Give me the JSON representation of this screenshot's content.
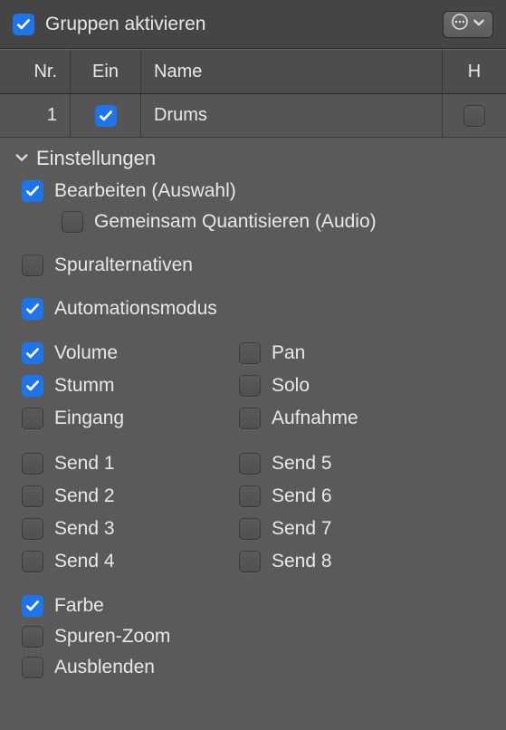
{
  "header": {
    "enable_groups_label": "Gruppen aktivieren",
    "enable_groups_checked": true
  },
  "table": {
    "columns": {
      "nr": "Nr.",
      "ein": "Ein",
      "name": "Name",
      "h": "H"
    },
    "row": {
      "nr": "1",
      "ein_checked": true,
      "name": "Drums",
      "h_checked": false
    }
  },
  "settings": {
    "title": "Einstellungen",
    "edit_selection": {
      "label": "Bearbeiten (Auswahl)",
      "checked": true
    },
    "quantize_locked": {
      "label": "Gemeinsam Quantisieren (Audio)",
      "checked": false
    },
    "track_alternatives": {
      "label": "Spuralternativen",
      "checked": false
    },
    "automation_mode": {
      "label": "Automationsmodus",
      "checked": true
    },
    "volume": {
      "label": "Volume",
      "checked": true
    },
    "pan": {
      "label": "Pan",
      "checked": false
    },
    "mute": {
      "label": "Stumm",
      "checked": true
    },
    "solo": {
      "label": "Solo",
      "checked": false
    },
    "input": {
      "label": "Eingang",
      "checked": false
    },
    "record": {
      "label": "Aufnahme",
      "checked": false
    },
    "send1": {
      "label": "Send 1",
      "checked": false
    },
    "send2": {
      "label": "Send 2",
      "checked": false
    },
    "send3": {
      "label": "Send 3",
      "checked": false
    },
    "send4": {
      "label": "Send 4",
      "checked": false
    },
    "send5": {
      "label": "Send 5",
      "checked": false
    },
    "send6": {
      "label": "Send 6",
      "checked": false
    },
    "send7": {
      "label": "Send 7",
      "checked": false
    },
    "send8": {
      "label": "Send 8",
      "checked": false
    },
    "color": {
      "label": "Farbe",
      "checked": true
    },
    "track_zoom": {
      "label": "Spuren-Zoom",
      "checked": false
    },
    "hide": {
      "label": "Ausblenden",
      "checked": false
    }
  }
}
